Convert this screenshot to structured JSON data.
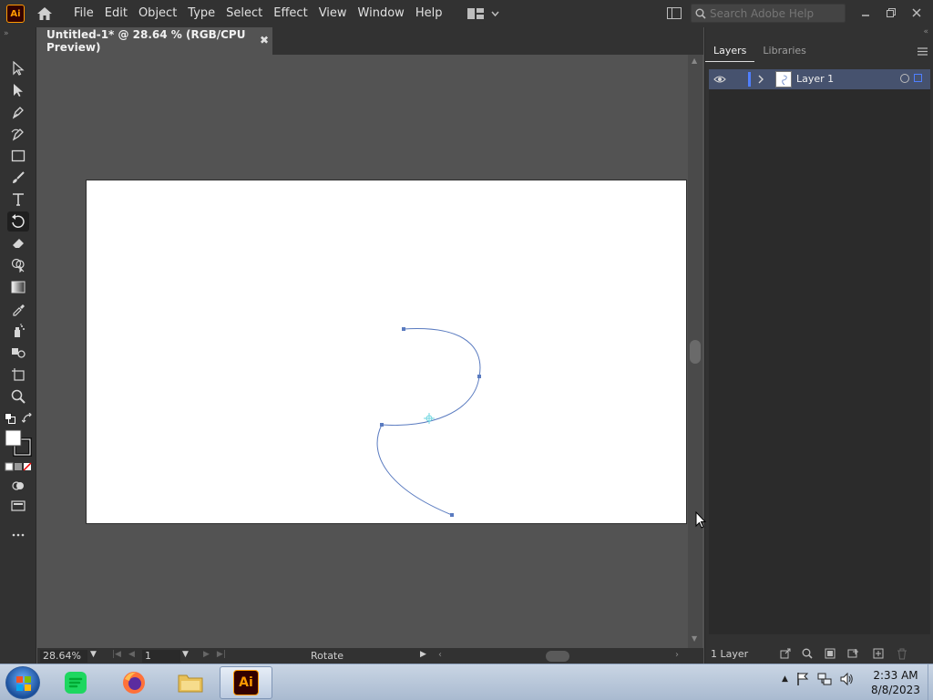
{
  "app": {
    "logo_text": "Ai",
    "menus": [
      "File",
      "Edit",
      "Object",
      "Type",
      "Select",
      "Effect",
      "View",
      "Window",
      "Help"
    ],
    "search": {
      "placeholder": "Search Adobe Help"
    }
  },
  "document": {
    "tab_title": "Untitled-1* @ 28.64 % (RGB/CPU Preview)",
    "close_glyph": "✖"
  },
  "status": {
    "zoom": "28.64%",
    "artboard": "1",
    "tool": "Rotate"
  },
  "panel": {
    "tabs": [
      "Layers",
      "Libraries"
    ],
    "layers": [
      {
        "name": "Layer 1"
      }
    ],
    "layer_count": "1 Layer"
  },
  "taskbar": {
    "app_label": "Ai",
    "time": "2:33 AM",
    "date": "8/8/2023"
  },
  "colors": {
    "ui_dark": "#323232",
    "canvas_bg": "#535353",
    "path_stroke": "#5a7bc0",
    "layer_highlight": "#46526e",
    "layer_color": "#4f7fff",
    "ai_brand": "#ff9a00"
  },
  "icons": {
    "home": "home-icon",
    "tools": [
      "selection-tool-icon",
      "direct-selection-tool-icon",
      "pen-tool-icon",
      "curvature-tool-icon",
      "rectangle-tool-icon",
      "paintbrush-tool-icon",
      "type-tool-icon",
      "rotate-tool-icon",
      "eraser-tool-icon",
      "shape-builder-tool-icon",
      "gradient-tool-icon",
      "eyedropper-tool-icon",
      "symbol-sprayer-tool-icon",
      "blend-tool-icon",
      "artboard-tool-icon",
      "zoom-tool-icon"
    ]
  }
}
